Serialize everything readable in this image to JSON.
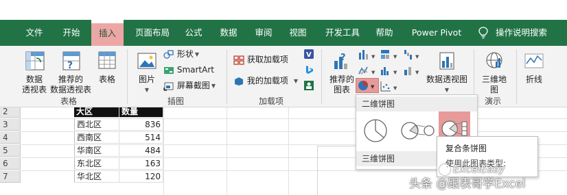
{
  "tabs": [
    "文件",
    "开始",
    "插入",
    "页面布局",
    "公式",
    "数据",
    "审阅",
    "视图",
    "开发工具",
    "帮助",
    "Power Pivot"
  ],
  "active_tab": "插入",
  "tell_me": "操作说明搜索",
  "ribbon": {
    "tables": {
      "pivot_line1": "数据",
      "pivot_line2": "透视表",
      "rec_pivot_line1": "推荐的",
      "rec_pivot_line2": "数据透视表",
      "table": "表格",
      "group_label": "表格"
    },
    "illustrations": {
      "pictures": "图片",
      "shapes": "形状",
      "smartart": "SmartArt",
      "screenshot": "屏幕截图",
      "group_label": "插图"
    },
    "addins": {
      "get": "获取加载项",
      "mine": "我的加载项",
      "group_label": "加载项"
    },
    "charts": {
      "rec_line1": "推荐的",
      "rec_line2": "图表",
      "pivot_chart": "数据透视图"
    },
    "tours": {
      "map_line1": "三维地",
      "map_line2": "图",
      "group_label": "演示"
    },
    "sparklines": {
      "line": "折线"
    }
  },
  "sheet": {
    "row_numbers": [
      "2",
      "3",
      "4",
      "5",
      "6",
      "7"
    ],
    "header": [
      "大区",
      "数量"
    ],
    "rows": [
      [
        "西北区",
        "836"
      ],
      [
        "西南区",
        "514"
      ],
      [
        "华南区",
        "484"
      ],
      [
        "东北区",
        "163"
      ],
      [
        "华北区",
        "120"
      ]
    ]
  },
  "pie_menu": {
    "section_2d": "二维饼图",
    "section_3d": "三维饼图",
    "tooltip_title": "复合条饼图",
    "tooltip_body": "使用此图表类型:"
  },
  "watermark": {
    "line1": "ExcelEasy",
    "line2": "头条 @跟表哥学Excel"
  },
  "colors": {
    "excel_green": "#217346",
    "highlight": "#e79a9a"
  }
}
